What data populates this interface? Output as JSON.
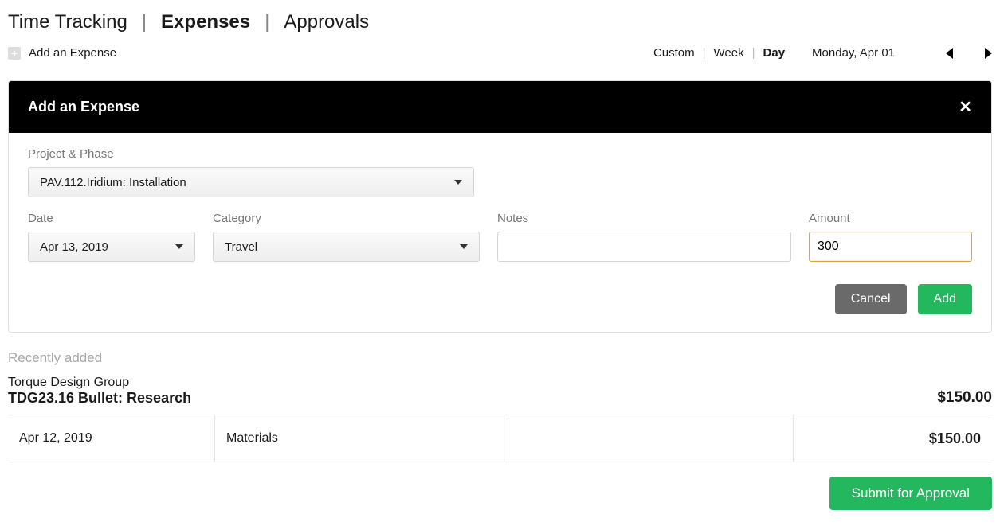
{
  "tabs": {
    "time_tracking": "Time Tracking",
    "expenses": "Expenses",
    "approvals": "Approvals"
  },
  "subbar": {
    "add_label": "Add an Expense",
    "range": {
      "custom": "Custom",
      "week": "Week",
      "day": "Day"
    },
    "date_display": "Monday, Apr 01"
  },
  "modal": {
    "title": "Add an Expense",
    "labels": {
      "project": "Project & Phase",
      "date": "Date",
      "category": "Category",
      "notes": "Notes",
      "amount": "Amount"
    },
    "values": {
      "project": "PAV.112.Iridium: Installation",
      "date": "Apr 13, 2019",
      "category": "Travel",
      "notes": "",
      "amount": "300"
    },
    "buttons": {
      "cancel": "Cancel",
      "add": "Add"
    }
  },
  "recent": {
    "heading": "Recently added",
    "company": "Torque Design Group",
    "project": "TDG23.16 Bullet: Research",
    "total": "$150.00",
    "rows": [
      {
        "date": "Apr 12, 2019",
        "category": "Materials",
        "notes": "",
        "amount": "$150.00"
      }
    ],
    "submit_label": "Submit for Approval"
  }
}
